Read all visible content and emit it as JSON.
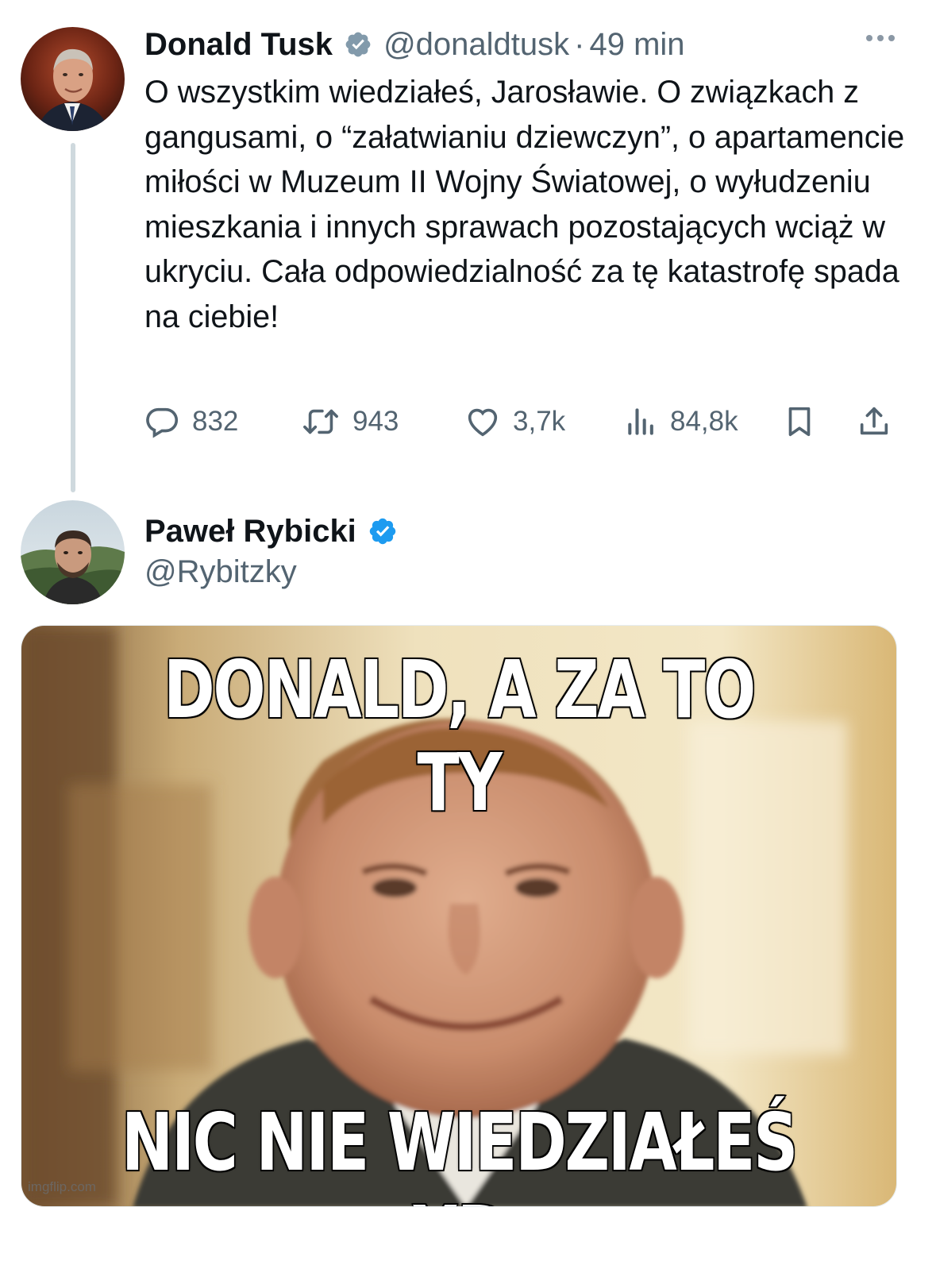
{
  "tweet1": {
    "name": "Donald Tusk",
    "handle": "@donaldtusk",
    "separator": "·",
    "time": "49 min",
    "text": "O wszystkim wiedziałeś, Jarosławie. O związkach z gangusami, o “załatwianiu dziewczyn”, o apartamencie miłości w Muzeum II Wojny Światowej, o wyłudzeniu mieszkania i innych sprawach pozostających wciąż w ukryciu. Cała odpowiedzialność za tę katastrofę spada na ciebie!",
    "stats": {
      "replies": "832",
      "reposts": "943",
      "likes": "3,7k",
      "views": "84,8k"
    },
    "colors": {
      "verified_badge": "#829aab"
    }
  },
  "tweet2": {
    "name": "Paweł Rybicki",
    "handle": "@Rybitzky",
    "colors": {
      "verified_badge": "#1d9bf0"
    },
    "media": {
      "top_caption": "DONALD, A ZA TO TY",
      "bottom_caption": "NIC NIE WIEDZIAŁEŚ XD",
      "watermark": "imgflip.com"
    }
  },
  "colors": {
    "text_primary": "#0f1419",
    "text_secondary": "#536471",
    "thread_line": "#cfd9de"
  },
  "icons": [
    "more-icon",
    "reply-icon",
    "repost-icon",
    "like-icon",
    "views-icon",
    "bookmark-icon",
    "share-icon",
    "verified-icon"
  ]
}
